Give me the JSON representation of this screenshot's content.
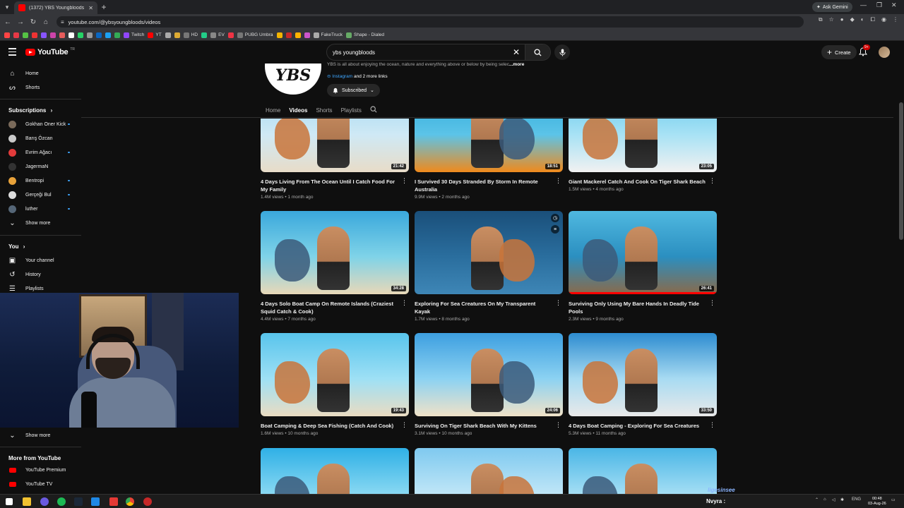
{
  "browser": {
    "tab_title": "(1372) YBS Youngbloods - YouTube",
    "url": "youtube.com/@ybsyoungbloods/videos",
    "ask_gemini": "Ask Gemini",
    "bookmarks": [
      {
        "label": "",
        "color": "#ff4444"
      },
      {
        "label": "",
        "color": "#e63946"
      },
      {
        "label": "",
        "color": "#55c244"
      },
      {
        "label": "",
        "color": "#ee3333"
      },
      {
        "label": "",
        "color": "#8855ff"
      },
      {
        "label": "",
        "color": "#cc44aa"
      },
      {
        "label": "",
        "color": "#e65c5c"
      },
      {
        "label": "",
        "color": "#ffffff"
      },
      {
        "label": "",
        "color": "#25d366"
      },
      {
        "label": "",
        "color": "#999999"
      },
      {
        "label": "",
        "color": "#0a66c2"
      },
      {
        "label": "",
        "color": "#1da1f2"
      },
      {
        "label": "",
        "color": "#33aa55"
      },
      {
        "label": "Twitch",
        "color": "#9146ff"
      },
      {
        "label": "YT",
        "color": "#ff0000"
      },
      {
        "label": "",
        "color": "#aaaaaa"
      },
      {
        "label": "",
        "color": "#ddaa33"
      },
      {
        "label": "HD",
        "color": "#777777"
      },
      {
        "label": "",
        "color": "#22cc88"
      },
      {
        "label": "EV",
        "color": "#888888"
      },
      {
        "label": "",
        "color": "#ee3344"
      },
      {
        "label": "PUBG Umbra",
        "color": "#777777"
      },
      {
        "label": "",
        "color": "#f4b400"
      },
      {
        "label": "",
        "color": "#c62828"
      },
      {
        "label": "",
        "color": "#ffb300"
      },
      {
        "label": "",
        "color": "#cc55cc"
      },
      {
        "label": "FakeTruck",
        "color": "#aaaaaa"
      },
      {
        "label": "Shape - Dialed",
        "color": "#66aa66"
      }
    ]
  },
  "masthead": {
    "logo": "YouTube",
    "logo_region": "TR",
    "search_query": "ybs youngbloods",
    "create_label": "Create",
    "notification_count": "9+"
  },
  "sidebar": {
    "home": "Home",
    "shorts": "Shorts",
    "subscriptions_heading": "Subscriptions",
    "subscriptions": [
      {
        "name": "Gokhan Oner Kick",
        "color": "#7a6a5a",
        "live": true
      },
      {
        "name": "Barış Özcan",
        "color": "#c9c9c9",
        "live": false
      },
      {
        "name": "Evrim Ağacı",
        "color": "#e23b3b",
        "live": true
      },
      {
        "name": "JagermaN",
        "color": "#333333",
        "live": false
      },
      {
        "name": "Bentropi",
        "color": "#e8a23a",
        "live": true
      },
      {
        "name": "Gerçeği Bul",
        "color": "#dddddd",
        "live": true
      },
      {
        "name": "luther",
        "color": "#556677",
        "live": true
      }
    ],
    "show_more": "Show more",
    "you_heading": "You",
    "your_channel": "Your channel",
    "history": "History",
    "playlists": "Playlists",
    "show_more_2": "Show more",
    "more_from_youtube": "More from YouTube",
    "youtube_premium": "YouTube Premium",
    "youtube_tv": "YouTube TV"
  },
  "channel": {
    "avatar_text": "YBS",
    "description": "YBS is all about enjoying the ocean, nature and everything above or below by being selec",
    "more": "...more",
    "instagram": "Instagram",
    "more_links": " and 2 more links",
    "subscribed": "Subscribed",
    "tabs": [
      "Home",
      "Videos",
      "Shorts",
      "Playlists"
    ],
    "active_tab": "Videos"
  },
  "videos": [
    {
      "title": "4 Days Living From The Ocean Until I Catch Food For My Family",
      "meta": "1.4M views • 1 month ago",
      "duration": "21:42",
      "watched": 0,
      "palette": [
        "#9fd6f0",
        "#cfe9f5",
        "#e8dcc8"
      ]
    },
    {
      "title": "I Survived 30 Days Stranded By Storm In Remote Australia",
      "meta": "9.9M views • 2 months ago",
      "duration": "18:51",
      "watched": 0,
      "palette": [
        "#2aa6d8",
        "#5cc4e8",
        "#f08a1c"
      ]
    },
    {
      "title": "Giant Mackerel Catch And Cook On Tiger Shark Beach",
      "meta": "1.5M views • 4 months ago",
      "duration": "23:05",
      "watched": 0,
      "palette": [
        "#5ec6ea",
        "#a8e2f5",
        "#f1f1f1"
      ]
    },
    {
      "title": "4 Days Solo Boat Camp On Remote Islands (Craziest Squid Catch & Cook)",
      "meta": "4.4M views • 7 months ago",
      "duration": "34:28",
      "watched": 0,
      "palette": [
        "#3aa8dc",
        "#7fd3e8",
        "#e8d8b8"
      ]
    },
    {
      "title": "Exploring For Sea Creatures On My Transparent Kayak",
      "meta": "1.7M views • 8 months ago",
      "duration": "",
      "watched": 0,
      "palette": [
        "#1a4f7a",
        "#2a6e9e",
        "#3e86b6"
      ]
    },
    {
      "title": "Surviving Only Using My Bare Hands In Deadly Tide Pools",
      "meta": "2.3M views • 9 months ago",
      "duration": "26:41",
      "watched": 1,
      "palette": [
        "#4fb8e0",
        "#2b8fc0",
        "#8a6a4a"
      ]
    },
    {
      "title": "Boat Camping & Deep Sea Fishing (Catch And Cook)",
      "meta": "1.6M views • 10 months ago",
      "duration": "19:43",
      "watched": 0,
      "palette": [
        "#58c4ec",
        "#9ee0f5",
        "#eadcc2"
      ]
    },
    {
      "title": "Surviving On Tiger Shark Beach With My Kittens",
      "meta": "3.1M views • 10 months ago",
      "duration": "24:06",
      "watched": 0,
      "palette": [
        "#3d9fe0",
        "#8cd2f2",
        "#f0e2c8"
      ]
    },
    {
      "title": "4 Days Boat Camping - Exploring For Sea Creatures",
      "meta": "5.3M views • 11 months ago",
      "duration": "33:50",
      "watched": 0,
      "palette": [
        "#2d8cd0",
        "#a8dbf2",
        "#e9e9e9"
      ]
    },
    {
      "title": "",
      "meta": "",
      "duration": "",
      "watched": 0,
      "palette": [
        "#2fb0e6",
        "#88d8f2",
        "#f1e0c8"
      ]
    },
    {
      "title": "",
      "meta": "",
      "duration": "",
      "watched": 0,
      "palette": [
        "#7fc9ef",
        "#bfe6f7",
        "#e2e2e2"
      ]
    },
    {
      "title": "",
      "meta": "",
      "duration": "",
      "watched": 0,
      "palette": [
        "#4ab6e6",
        "#a4def4",
        "#f2f2f2"
      ]
    }
  ],
  "taskbar": {
    "overlay_name": "Nvyra :",
    "lang": "ENG",
    "time": "00:48",
    "date": "03-Aug-26"
  }
}
